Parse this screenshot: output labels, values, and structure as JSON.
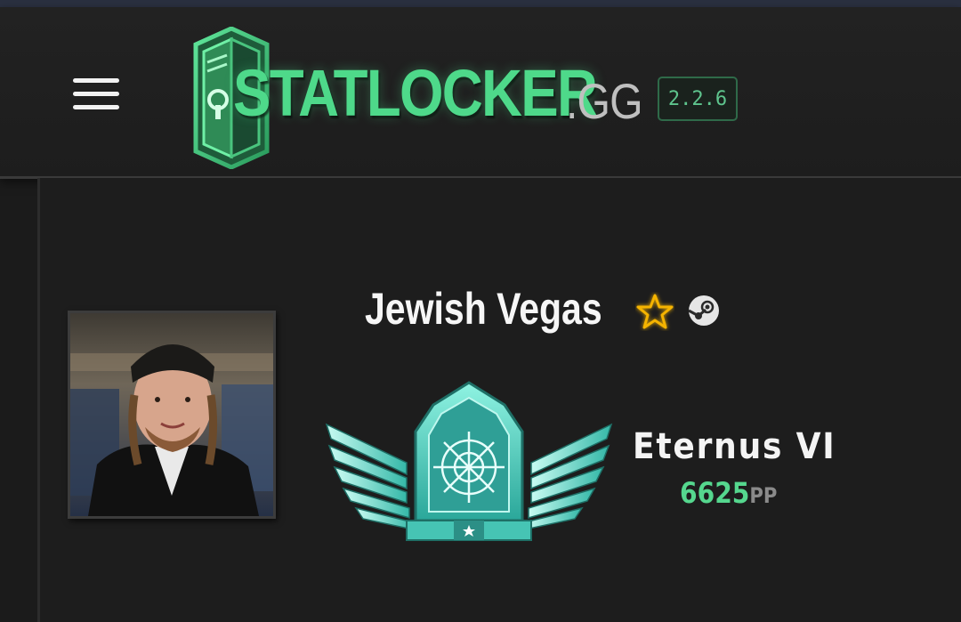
{
  "app": {
    "logo_text": "STATLOCKER",
    "logo_tld": ".GG",
    "version": "2.2.6"
  },
  "profile": {
    "player_name": "Jewish Vegas",
    "rank_name": "Eternus VI",
    "rank_points": "6625",
    "rank_points_unit": "PP"
  },
  "icons": {
    "menu": "hamburger-menu-icon",
    "logo": "locker-logo-icon",
    "favorite": "star-icon",
    "steam": "steam-icon",
    "rank": "eternus-rank-badge"
  },
  "colors": {
    "accent": "#4ed98a",
    "star": "#f5b400",
    "rank_teal": "#4fd8c2"
  }
}
